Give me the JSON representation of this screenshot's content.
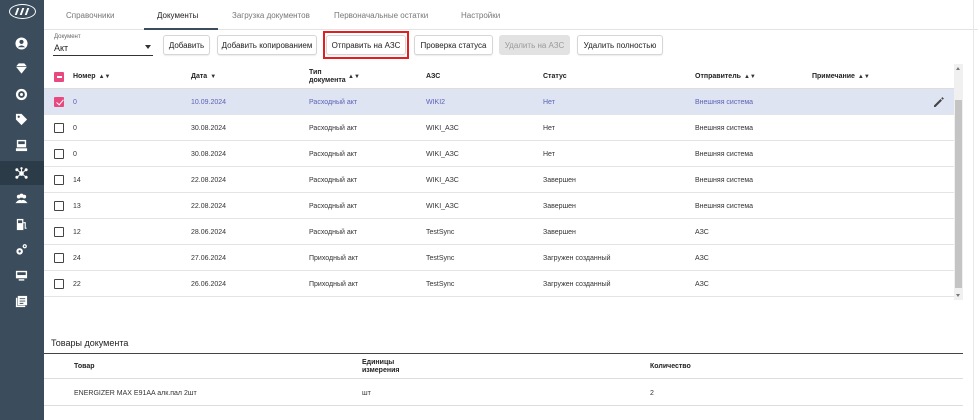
{
  "tabs": [
    "Справочники",
    "Документы",
    "Загрузка документов",
    "Первоначальные остатки",
    "Настройки"
  ],
  "doc_select": {
    "label": "Документ",
    "value": "Акт"
  },
  "toolbar": {
    "add": "Добавить",
    "add_copy": "Добавить копированием",
    "send": "Отправить на АЗС",
    "check_status": "Проверка статуса",
    "delete_at_azs": "Удалить на АЗС",
    "delete_full": "Удалить полностью"
  },
  "columns": {
    "number": "Номер",
    "date": "Дата",
    "doc_type": "Тип документа",
    "azs": "АЗС",
    "status": "Статус",
    "sender": "Отправитель",
    "note": "Примечание"
  },
  "rows": [
    {
      "number": "0",
      "date": "10.09.2024",
      "type": "Расходный акт",
      "azs": "WIKI2",
      "status": "Нет",
      "sender": "Внешняя система",
      "selected": true
    },
    {
      "number": "0",
      "date": "30.08.2024",
      "type": "Расходный акт",
      "azs": "WIKI_АЗС",
      "status": "Нет",
      "sender": "Внешняя система"
    },
    {
      "number": "0",
      "date": "30.08.2024",
      "type": "Расходный акт",
      "azs": "WIKI_АЗС",
      "status": "Нет",
      "sender": "Внешняя система"
    },
    {
      "number": "14",
      "date": "22.08.2024",
      "type": "Расходный акт",
      "azs": "WIKI_АЗС",
      "status": "Завершен",
      "sender": "Внешняя система"
    },
    {
      "number": "13",
      "date": "22.08.2024",
      "type": "Расходный акт",
      "azs": "WIKI_АЗС",
      "status": "Завершен",
      "sender": "Внешняя система"
    },
    {
      "number": "12",
      "date": "28.06.2024",
      "type": "Расходный акт",
      "azs": "TestSync",
      "status": "Завершен",
      "sender": "АЗС"
    },
    {
      "number": "24",
      "date": "27.06.2024",
      "type": "Приходный акт",
      "azs": "TestSync",
      "status": "Загружен созданный",
      "sender": "АЗС"
    },
    {
      "number": "22",
      "date": "26.06.2024",
      "type": "Приходный акт",
      "azs": "TestSync",
      "status": "Загружен созданный",
      "sender": "АЗС"
    }
  ],
  "goods": {
    "title": "Товары документа",
    "columns": {
      "product": "Товар",
      "unit": "Единицы измерения",
      "qty": "Количество"
    },
    "rows": [
      {
        "product": "ENERGIZER MAX E91AA алк.пал 2шт",
        "unit": "шт",
        "qty": "2"
      }
    ]
  },
  "colors": {
    "sidebar": "#3b4d5c",
    "accent": "#e84a7f",
    "highlight": "#e02020",
    "selected_row": "#dfe4f3"
  },
  "sidebar_icons": [
    "logo-icon",
    "user-icon",
    "diamond-icon",
    "gauge-icon",
    "tag-icon",
    "register-icon",
    "network-icon",
    "users-icon",
    "fuel-icon",
    "gears-icon",
    "monitor-icon",
    "list-icon"
  ]
}
